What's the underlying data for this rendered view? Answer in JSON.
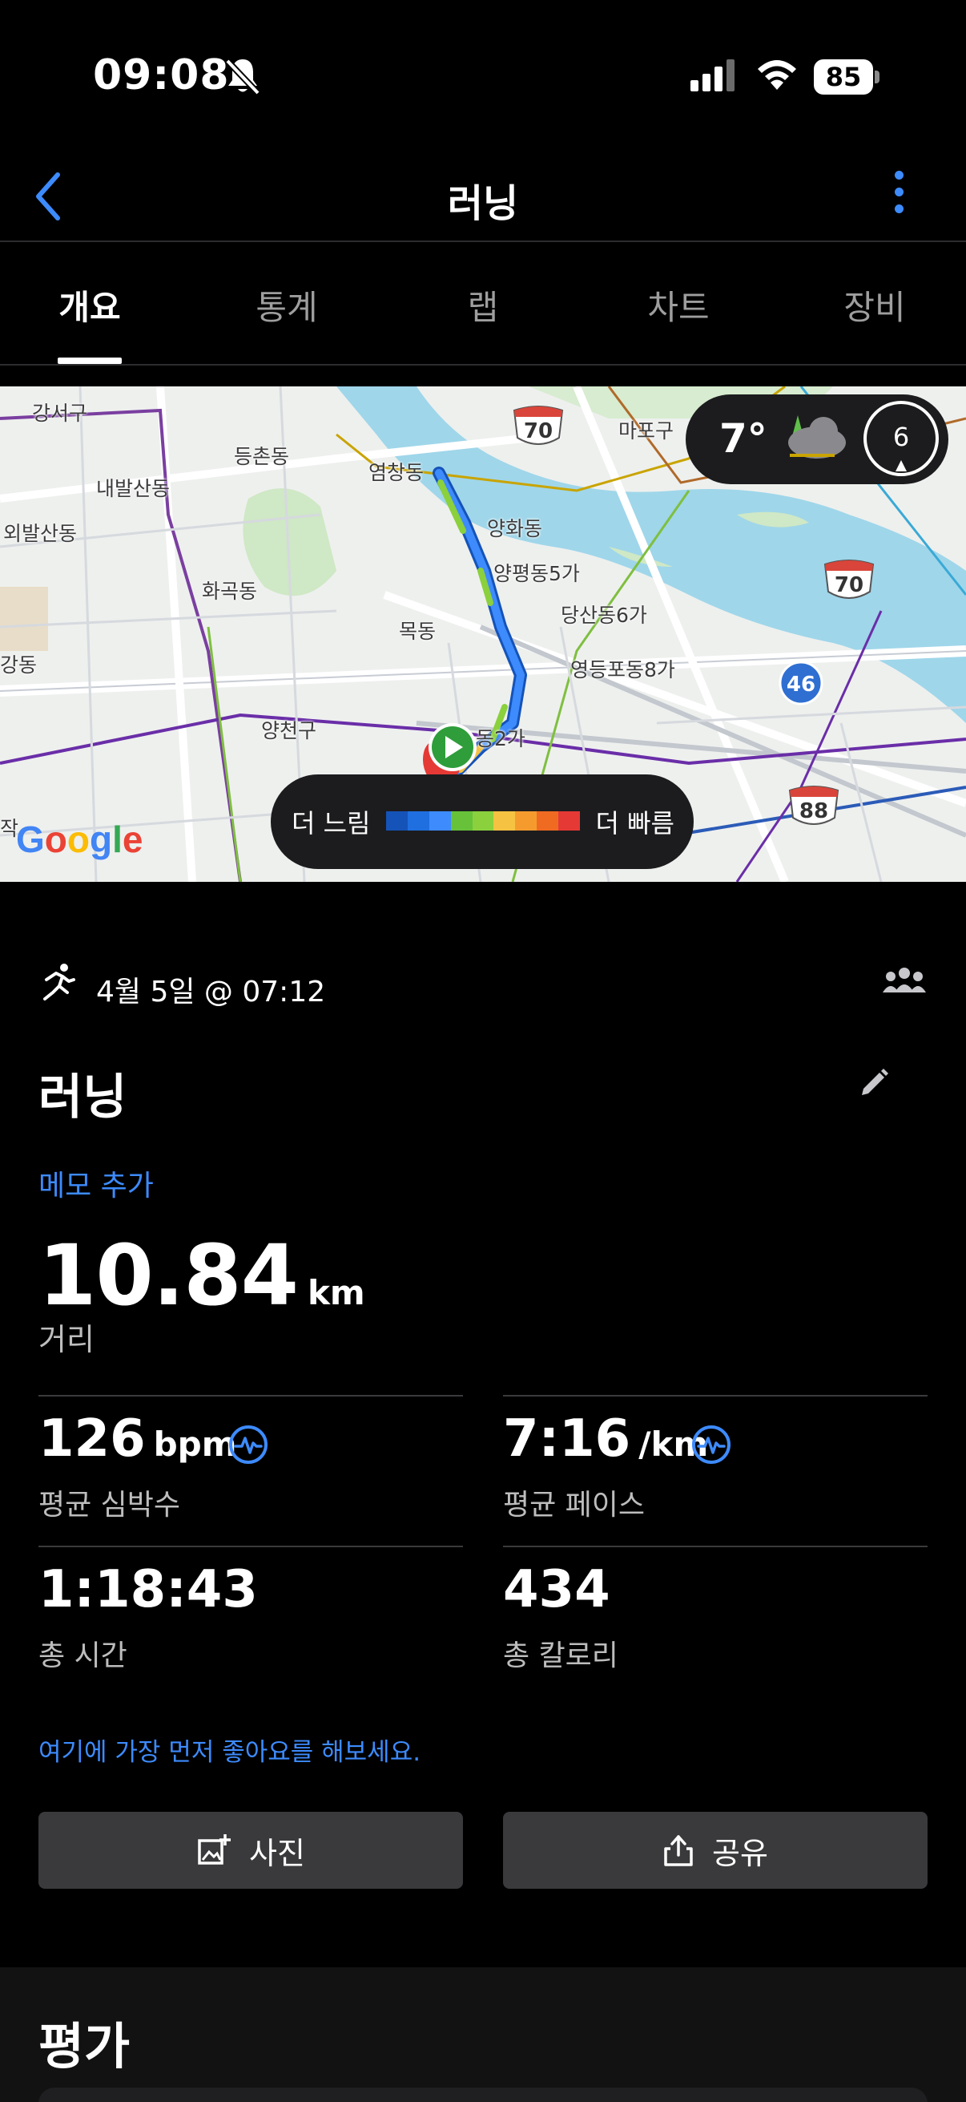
{
  "status_bar": {
    "time": "09:08",
    "battery": "85"
  },
  "nav": {
    "title": "러닝"
  },
  "tabs": [
    {
      "label": "개요"
    },
    {
      "label": "통계"
    },
    {
      "label": "랩"
    },
    {
      "label": "차트"
    },
    {
      "label": "장비"
    }
  ],
  "map": {
    "labels": {
      "gangseogu": "강서구",
      "deungchon": "등촌동",
      "naebalsan": "내발산동",
      "oebalsan": "외발산동",
      "hwagok": "화곡동",
      "gangdong": "강동",
      "yeomchang": "염창동",
      "yanghwa": "양화동",
      "yangpyeong": "양평동5가",
      "mok": "목동",
      "yangcheon": "양천구",
      "dangsan": "당산동6가",
      "yeongdeungpo": "영등포동8가",
      "dong2": "동2가",
      "mapo": "마포구",
      "jak": "작"
    },
    "road_shields": {
      "r70a": "70",
      "r70b": "70",
      "r46": "46",
      "r88": "88"
    },
    "weather": {
      "temp": "7°",
      "wind": "6"
    },
    "legend": {
      "slow": "더 느림",
      "fast": "더 빠름",
      "colors": [
        "#1553b8",
        "#1f6fe0",
        "#3d8bfd",
        "#67c23a",
        "#8bd03d",
        "#f5c242",
        "#f59b2e",
        "#ef6b22",
        "#e53935"
      ]
    },
    "brand": [
      "G",
      "o",
      "o",
      "g",
      "l",
      "e"
    ]
  },
  "activity": {
    "date": "4월 5일 @ 07:12",
    "title": "러닝",
    "memo": "메모 추가",
    "distance": {
      "value": "10.84",
      "unit": "km",
      "label": "거리"
    },
    "stats": {
      "hr": {
        "value": "126",
        "unit": "bpm",
        "label": "평균 심박수"
      },
      "pace": {
        "value": "7:16",
        "unit": "/km",
        "label": "평균 페이스"
      },
      "time": {
        "value": "1:18:43",
        "label": "총 시간"
      },
      "calories": {
        "value": "434",
        "label": "총 칼로리"
      }
    },
    "like_prompt": "여기에 가장 먼저 좋아요를 해보세요.",
    "photo_button": "사진",
    "share_button": "공유"
  },
  "rating": {
    "title": "평가"
  }
}
